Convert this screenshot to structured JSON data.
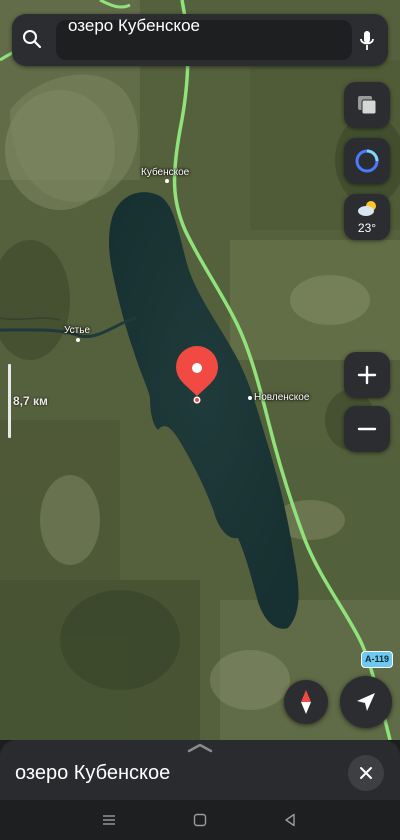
{
  "search": {
    "query": "озеро Кубенское"
  },
  "map": {
    "places": [
      {
        "id": "kubenskoe",
        "name": "Кубенское"
      },
      {
        "id": "ustye",
        "name": "Устье"
      },
      {
        "id": "novlenskoe",
        "name": "Новленское"
      }
    ],
    "scale_label": "8,7 км",
    "road_badge": "А-119",
    "colors": {
      "road": "#8fe37a",
      "lake": "#1f3b3c",
      "pin": "#f04a43",
      "accent": "#3b82f6"
    }
  },
  "weather": {
    "temperature": "23°",
    "icon": "partly-cloudy-icon"
  },
  "controls": {
    "layers": "layers-icon",
    "alice": "alice-assistant-icon",
    "zoom_in": "plus-icon",
    "zoom_out": "minus-icon",
    "compass": "compass-icon",
    "locate": "location-arrow-icon"
  },
  "sheet": {
    "title": "озеро Кубенское"
  },
  "system_nav": [
    "menu-icon",
    "home-icon",
    "back-icon"
  ]
}
